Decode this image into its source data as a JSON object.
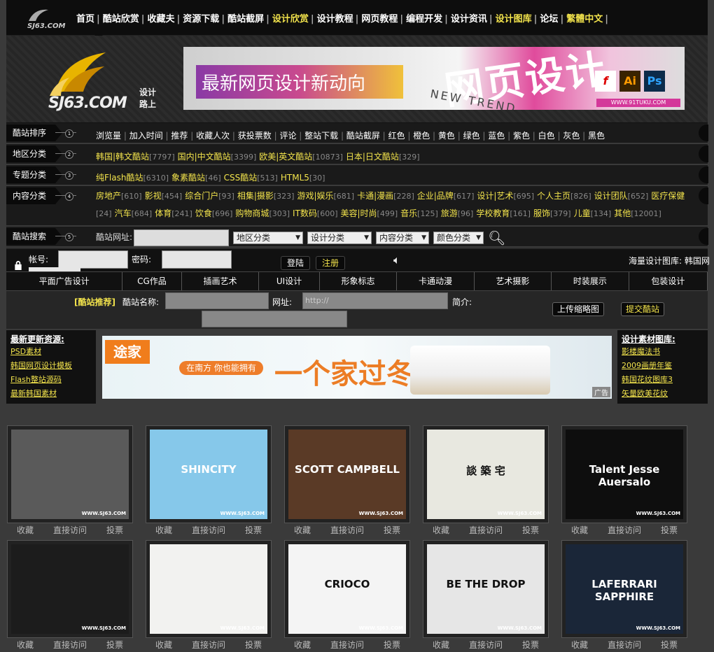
{
  "topnav": {
    "logo_text": "SJ63.COM",
    "items": [
      {
        "label": "首页",
        "hl": false
      },
      {
        "label": "酷站欣赏",
        "hl": false
      },
      {
        "label": "收藏夫",
        "hl": false
      },
      {
        "label": "资源下载",
        "hl": false
      },
      {
        "label": "酷站截屏",
        "hl": false
      },
      {
        "label": "设计欣赏",
        "hl": true
      },
      {
        "label": "设计教程",
        "hl": false
      },
      {
        "label": "网页教程",
        "hl": false
      },
      {
        "label": "编程开发",
        "hl": false
      },
      {
        "label": "设计资讯",
        "hl": false
      },
      {
        "label": "设计图库",
        "hl": true
      },
      {
        "label": "论坛",
        "hl": false
      },
      {
        "label": "繁體中文",
        "hl": true
      }
    ]
  },
  "header": {
    "logo_main": "SJ63.COM",
    "logo_sub": "设计路上",
    "banner_text": "最新网页设计新动向",
    "banner_big": "网页设计",
    "banner_new": "NEW TREND",
    "banner_site": "WWW.91TUKU.COM",
    "icons": [
      "flash-icon",
      "illustrator-icon",
      "photoshop-icon"
    ]
  },
  "categories": {
    "sort": {
      "label": "酷站排序",
      "num": "1",
      "items": [
        "浏览量",
        "加入时间",
        "推荐",
        "收藏人次",
        "获投票数",
        "评论",
        "整站下载",
        "酷站截屏",
        "红色",
        "橙色",
        "黄色",
        "绿色",
        "蓝色",
        "紫色",
        "白色",
        "灰色",
        "黑色"
      ]
    },
    "region": {
      "label": "地区分类",
      "num": "2",
      "items": [
        {
          "name": "韩国|韩文酷站",
          "count": "[7797]"
        },
        {
          "name": "国内|中文酷站",
          "count": "[3399]"
        },
        {
          "name": "欧美|英文酷站",
          "count": "[10873]"
        },
        {
          "name": "日本|日文酷站",
          "count": "[329]"
        }
      ]
    },
    "topic": {
      "label": "专题分类",
      "num": "3",
      "items": [
        {
          "name": "纯Flash酷站",
          "count": "[6310]"
        },
        {
          "name": "象素酷站",
          "count": "[46]"
        },
        {
          "name": "CSS酷站",
          "count": "[513]"
        },
        {
          "name": "HTML5",
          "count": "[30]"
        }
      ]
    },
    "content": {
      "label": "内容分类",
      "num": "4",
      "items": [
        {
          "name": "房地产",
          "count": "[610]"
        },
        {
          "name": "影视",
          "count": "[454]"
        },
        {
          "name": "综合门户",
          "count": "[93]"
        },
        {
          "name": "相集|摄影",
          "count": "[323]"
        },
        {
          "name": "游戏|娱乐",
          "count": "[681]"
        },
        {
          "name": "卡通|漫画",
          "count": "[228]"
        },
        {
          "name": "企业|品牌",
          "count": "[617]"
        },
        {
          "name": "设计|艺术",
          "count": "[695]"
        },
        {
          "name": "个人主页",
          "count": "[826]"
        },
        {
          "name": "设计团队",
          "count": "[652]"
        },
        {
          "name": "医疗保健",
          "count": "[24]"
        },
        {
          "name": "汽车",
          "count": "[684]"
        },
        {
          "name": "体育",
          "count": "[241]"
        },
        {
          "name": "饮食",
          "count": "[696]"
        },
        {
          "name": "购物商城",
          "count": "[303]"
        },
        {
          "name": "IT数码",
          "count": "[600]"
        },
        {
          "name": "美容|时尚",
          "count": "[499]"
        },
        {
          "name": "音乐",
          "count": "[125]"
        },
        {
          "name": "旅游",
          "count": "[96]"
        },
        {
          "name": "学校教育",
          "count": "[161]"
        },
        {
          "name": "服饰",
          "count": "[379]"
        },
        {
          "name": "儿童",
          "count": "[134]"
        },
        {
          "name": "其他",
          "count": "[12001]"
        }
      ]
    },
    "search": {
      "label": "酷站搜索",
      "num": "5",
      "url_label": "酷站网址:",
      "selects": [
        "地区分类",
        "设计分类",
        "内容分类",
        "颜色分类"
      ]
    }
  },
  "login": {
    "account_label": "帐号:",
    "password_label": "密码:",
    "login_btn": "登陆",
    "register_btn": "注册",
    "marquee": "海量设计图库: 韩国网"
  },
  "tabs": [
    "平面广告设计",
    "CG作品",
    "插画艺术",
    "UI设计",
    "形象标志",
    "卡通动漫",
    "艺术摄影",
    "时装展示",
    "包装设计"
  ],
  "submit": {
    "tag": "[酷站推荐]",
    "name_label": "酷站名称:",
    "url_label": "网址:",
    "url_value": "http://",
    "intro_label": "简介:",
    "upload_btn": "上传缩略图",
    "submit_btn": "提交酷站"
  },
  "left_panel": {
    "title": "最新更新资源:",
    "links": [
      "PSD素材",
      "韩国网页设计模板",
      "Flash整站源码",
      "最新韩国素材"
    ]
  },
  "right_panel": {
    "title": "设计素材图库:",
    "links": [
      "影楼魔法书",
      "2009画册年鉴",
      "韩国花纹图库3",
      "矢量欧美花纹"
    ]
  },
  "ad": {
    "logo": "途家",
    "pill": "在南方 你也能拥有",
    "big": "一个家过冬",
    "tag": "广告"
  },
  "thumbs": {
    "watermark": "WWW.SJ63.COM",
    "actions": [
      "收藏",
      "直接访问",
      "投票"
    ],
    "row1": [
      {
        "bg": "#5a5a5a",
        "text": ""
      },
      {
        "bg": "#86c8ea",
        "text": "SHINCITY"
      },
      {
        "bg": "#5a3a26",
        "text": "SCOTT CAMPBELL"
      },
      {
        "bg": "#e8e8e0",
        "text": "談 築 宅"
      },
      {
        "bg": "#0e0e0e",
        "text": "Talent Jesse Auersalo"
      }
    ],
    "row2": [
      {
        "bg": "#1c1c1c",
        "text": ""
      },
      {
        "bg": "#f2f2f0",
        "text": ""
      },
      {
        "bg": "#f4f4f4",
        "text": "CRIOCO"
      },
      {
        "bg": "#e6e6e6",
        "text": "BE THE DROP"
      },
      {
        "bg": "#1a2638",
        "text": "LAFERRARI SAPPHIRE"
      }
    ]
  }
}
